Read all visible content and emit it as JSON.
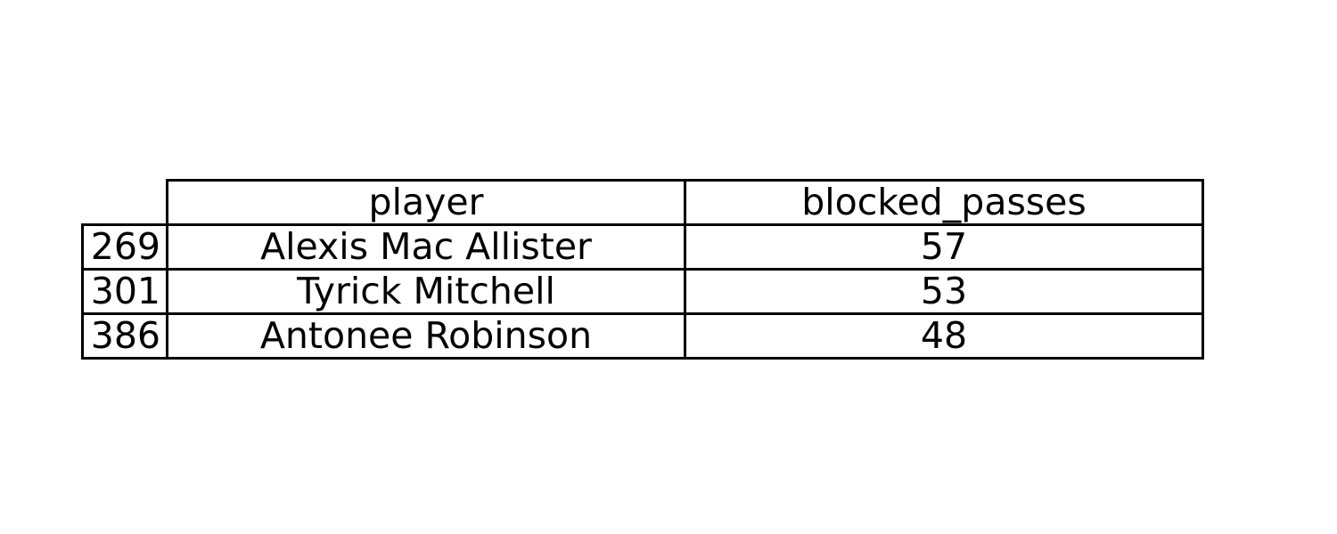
{
  "chart_data": {
    "type": "table",
    "columns": [
      "player",
      "blocked_passes"
    ],
    "rows": [
      {
        "index": "269",
        "player": "Alexis Mac Allister",
        "blocked_passes": "57"
      },
      {
        "index": "301",
        "player": "Tyrick Mitchell",
        "blocked_passes": "53"
      },
      {
        "index": "386",
        "player": "Antonee Robinson",
        "blocked_passes": "48"
      }
    ]
  }
}
